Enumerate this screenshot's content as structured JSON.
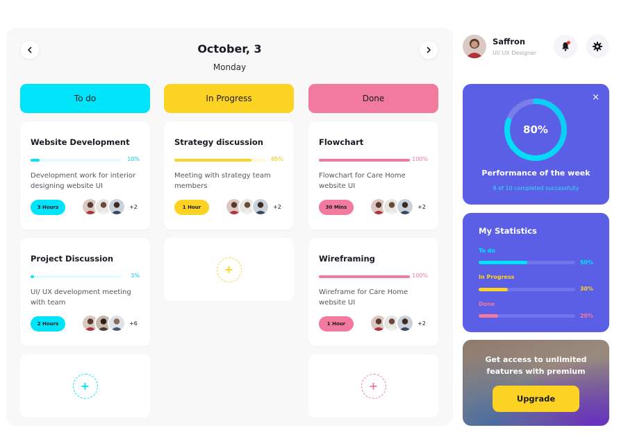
{
  "header": {
    "date": "October, 3",
    "day": "Monday"
  },
  "nav": {
    "prev_icon": "chevron-left-icon",
    "next_icon": "chevron-right-icon"
  },
  "colors": {
    "cyan": "#00e4fa",
    "yellow": "#fcd322",
    "pink": "#f27a9e",
    "purple": "#5a5fe6"
  },
  "columns": [
    {
      "label": "To do",
      "color": "#00e4fa"
    },
    {
      "label": "In Progress",
      "color": "#fcd322"
    },
    {
      "label": "Done",
      "color": "#f27a9e"
    }
  ],
  "cards": {
    "website": {
      "title": "Website Development",
      "progress": 10,
      "progress_label": "10%",
      "desc": "Development work for interior designing website UI",
      "time": "3 Hours",
      "more": "+2"
    },
    "project": {
      "title": "Project Discussion",
      "progress": 3,
      "progress_label": "3%",
      "desc": "UI/ UX development meeting with team",
      "time": "2 Hours",
      "more": "+6"
    },
    "strategy": {
      "title": "Strategy discussion",
      "progress": 85,
      "progress_label": "85%",
      "desc": "Meeting with strategy team members",
      "time": "1 Hour",
      "more": "+2"
    },
    "flowchart": {
      "title": "Flowchart",
      "progress": 100,
      "progress_label": "100%",
      "desc": "Flowchart for Care Home website UI",
      "time": "30 Mins",
      "more": "+2"
    },
    "wireframing": {
      "title": "Wireframing",
      "progress": 100,
      "progress_label": "100%",
      "desc": "Wireframe for Care Home website UI",
      "time": "1 Hour",
      "more": "+2"
    }
  },
  "add_label": "+",
  "profile": {
    "name": "Saffron",
    "role": "UI/ UX Designer",
    "bell_icon": "bell-icon",
    "settings_icon": "gear-icon"
  },
  "performance": {
    "percent": 80,
    "percent_label": "80%",
    "title": "Performance of the week",
    "subtitle": "8 of 10 completed successfully",
    "close": "×"
  },
  "statistics": {
    "title": "My Statistics",
    "items": [
      {
        "label": "To do",
        "percent": 50,
        "percent_label": "50%",
        "color": "#00e4fa"
      },
      {
        "label": "In Progress",
        "percent": 30,
        "percent_label": "30%",
        "color": "#fcd322"
      },
      {
        "label": "Done",
        "percent": 20,
        "percent_label": "20%",
        "color": "#f27a9e"
      }
    ]
  },
  "upgrade": {
    "text_line1": "Get access to unlimited",
    "text_line2": "features with premium",
    "button": "Upgrade"
  }
}
